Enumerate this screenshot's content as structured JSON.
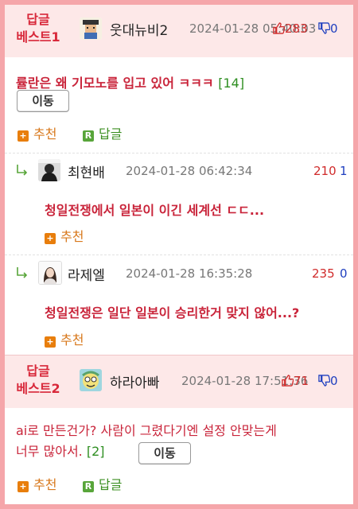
{
  "posts": [
    {
      "best_label_line1": "답글",
      "best_label_line2": "베스트1",
      "nick": "웃대뉴비2",
      "date": "2024-01-28 05:40:03",
      "up": "283",
      "down": "0",
      "title": "률란은 왜 기모노를 입고 있어 ㅋㅋㅋ",
      "comment_count": "[14]",
      "move_label": "이동",
      "recommend_label": "추천",
      "reply_label": "답글",
      "recommend_badge": "+",
      "reply_badge": "R"
    },
    {
      "best_label_line1": "답글",
      "best_label_line2": "베스트2",
      "nick": "하라아빠",
      "date": "2024-01-28 17:51:36",
      "up": "71",
      "down": "0",
      "body_line1": "ai로 만든건가? 사람이 그렸다기엔 설정 안맞는게",
      "body_line2": "너무 많아서.",
      "comment_count": "[2]",
      "move_label": "이동",
      "recommend_label": "추천",
      "reply_label": "답글",
      "recommend_badge": "+",
      "reply_badge": "R"
    }
  ],
  "replies": [
    {
      "nick": "최현배",
      "date": "2024-01-28 06:42:34",
      "up": "210",
      "down": "1",
      "text": "청일전쟁에서 일본이 이긴 세계선 ㄷㄷ...",
      "recommend_label": "추천",
      "recommend_badge": "+"
    },
    {
      "nick": "라제엘",
      "date": "2024-01-28 16:35:28",
      "up": "235",
      "down": "0",
      "text": "청일전쟁은 일단 일본이 승리한거 맞지 않어...?",
      "recommend_label": "추천",
      "recommend_badge": "+"
    }
  ],
  "colors": {
    "frame": "#f5a6aa",
    "best_bg": "#fde8e8",
    "best_label": "#d8283a",
    "title_red": "#c9243a",
    "up_red": "#d02b2b",
    "down_blue": "#1f3fbf",
    "recommend_orange": "#e87e0c",
    "reply_green": "#58a53a"
  },
  "icons": [
    "thumbs-up-icon",
    "thumbs-down-icon",
    "reply-arrow-icon",
    "recommend-plus-icon",
    "reply-r-icon"
  ]
}
